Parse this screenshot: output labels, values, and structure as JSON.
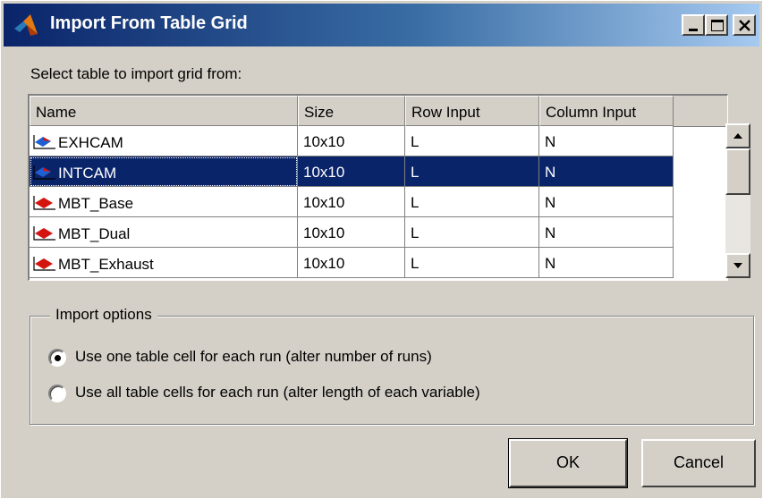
{
  "window": {
    "title": "Import From Table Grid"
  },
  "prompt": "Select table to import grid from:",
  "table": {
    "headers": [
      "Name",
      "Size",
      "Row Input",
      "Column Input"
    ],
    "rows": [
      {
        "name": "EXHCAM",
        "size": "10x10",
        "row_input": "L",
        "column_input": "N",
        "icon": "surface-table-icon"
      },
      {
        "name": "INTCAM",
        "size": "10x10",
        "row_input": "L",
        "column_input": "N",
        "icon": "surface-table-icon",
        "selected": true
      },
      {
        "name": "MBT_Base",
        "size": "10x10",
        "row_input": "L",
        "column_input": "N",
        "icon": "red-table-icon"
      },
      {
        "name": "MBT_Dual",
        "size": "10x10",
        "row_input": "L",
        "column_input": "N",
        "icon": "red-table-icon"
      },
      {
        "name": "MBT_Exhaust",
        "size": "10x10",
        "row_input": "L",
        "column_input": "N",
        "icon": "red-table-icon"
      }
    ]
  },
  "options": {
    "legend": "Import options",
    "radio1": "Use one table cell for each run (alter number of runs)",
    "radio2": "Use all table cells for each run (alter length of each variable)",
    "selected": 1
  },
  "buttons": {
    "ok": "OK",
    "cancel": "Cancel"
  },
  "colors": {
    "selection": "#0a246a",
    "titlebar_start": "#0a246a",
    "titlebar_end": "#a6caf0",
    "face": "#d4d0c8"
  }
}
